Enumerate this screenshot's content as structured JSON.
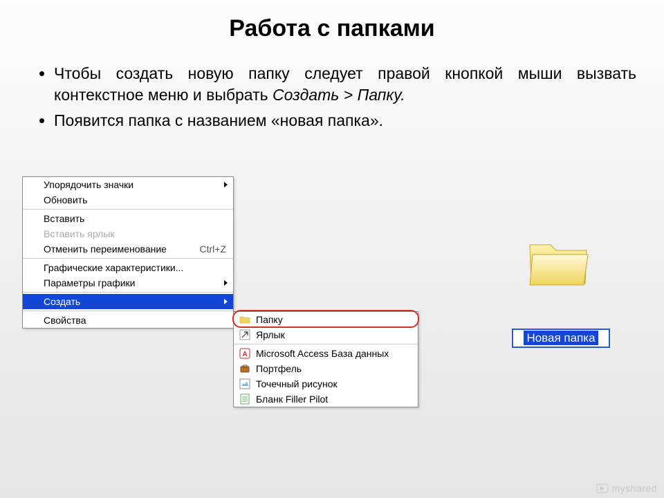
{
  "title": "Работа с папками",
  "bullets": [
    "Чтобы создать новую папку следует правой кнопкой мыши вызвать контекстное меню и выбрать <em>Создать > Папку.</em>",
    "Появится папка с названием «новая папка»."
  ],
  "context_menu": {
    "items": [
      {
        "label": "Упорядочить значки",
        "submenu": true
      },
      {
        "label": "Обновить"
      },
      {
        "sep": true
      },
      {
        "label": "Вставить"
      },
      {
        "label": "Вставить ярлык",
        "disabled": true
      },
      {
        "label": "Отменить переименование",
        "shortcut": "Ctrl+Z"
      },
      {
        "sep": true
      },
      {
        "label": "Графические характеристики..."
      },
      {
        "label": "Параметры графики",
        "submenu": true
      },
      {
        "sep": true
      },
      {
        "label": "Создать",
        "submenu": true,
        "selected": true
      },
      {
        "sep": true
      },
      {
        "label": "Свойства"
      }
    ]
  },
  "create_submenu": {
    "items": [
      {
        "label": "Папку",
        "icon": "folder-icon"
      },
      {
        "label": "Ярлык",
        "icon": "shortcut-icon"
      },
      {
        "sep": true
      },
      {
        "label": "Microsoft Access База данных",
        "icon": "access-icon"
      },
      {
        "label": "Портфель",
        "icon": "briefcase-icon"
      },
      {
        "label": "Точечный рисунок",
        "icon": "bitmap-icon"
      },
      {
        "label": "Бланк Filler Pilot",
        "icon": "form-icon"
      }
    ]
  },
  "new_folder": {
    "label": "Новая папка"
  },
  "watermark": "myshared"
}
